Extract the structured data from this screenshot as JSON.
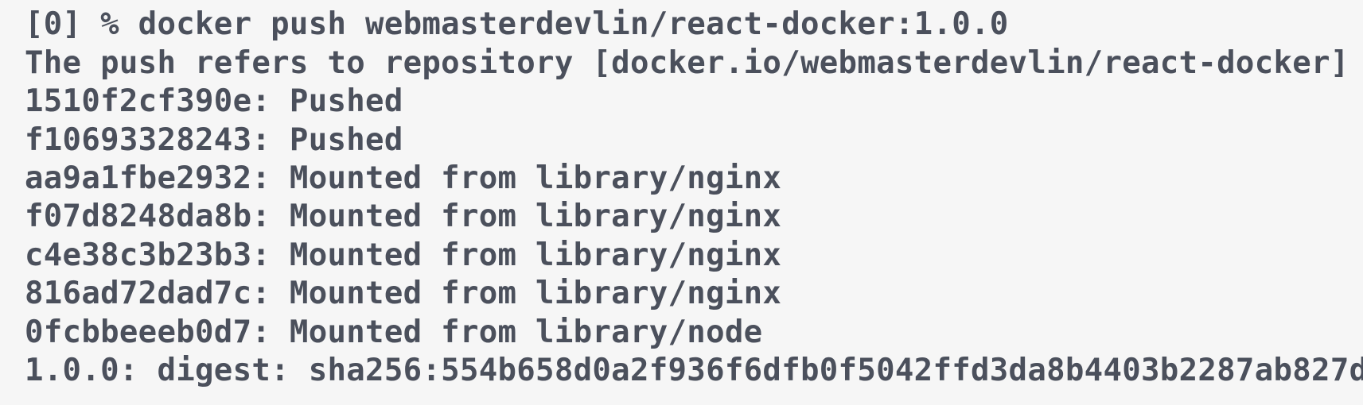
{
  "terminal": {
    "lines": [
      "",
      "[0] % docker push webmasterdevlin/react-docker:1.0.0",
      "The push refers to repository [docker.io/webmasterdevlin/react-docker]",
      "1510f2cf390e: Pushed",
      "f10693328243: Pushed",
      "aa9a1fbe2932: Mounted from library/nginx",
      "f07d8248da8b: Mounted from library/nginx",
      "c4e38c3b23b3: Mounted from library/nginx",
      "816ad72dad7c: Mounted from library/nginx",
      "0fcbbeeeb0d7: Mounted from library/node",
      "1.0.0: digest: sha256:554b658d0a2f936f6dfb0f5042ffd3da8b4403b2287ab827d"
    ]
  },
  "colors": {
    "background": "#f6f6f6",
    "text": "#4b505c"
  }
}
